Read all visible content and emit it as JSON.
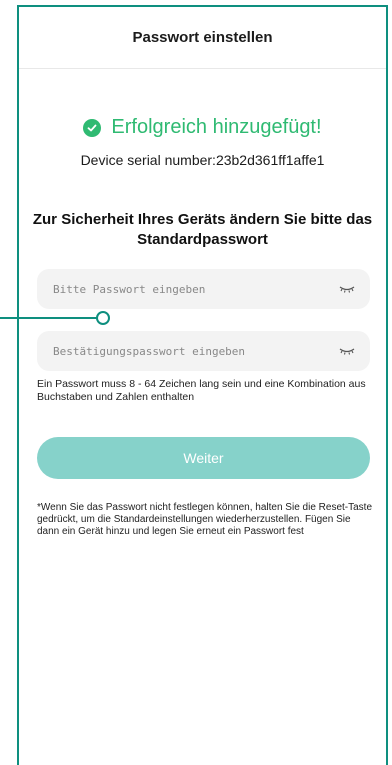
{
  "header": {
    "title": "Passwort einstellen"
  },
  "success": {
    "text": "Erfolgreich hinzugefügt!",
    "icon": "check-circle-icon",
    "color": "#2fba72"
  },
  "device": {
    "serial_line": "Device serial number:23b2d361ff1affe1"
  },
  "heading": "Zur Sicherheit Ihres Geräts ändern Sie bitte das Standardpasswort",
  "fields": {
    "password_placeholder": "Bitte Passwort eingeben",
    "confirm_placeholder": "Bestätigungspasswort eingeben"
  },
  "hint": "Ein Passwort muss 8 - 64 Zeichen lang sein und eine Kombination aus Buchstaben und Zahlen enthalten",
  "button": {
    "label": "Weiter",
    "color": "#86d2ca"
  },
  "note": "*Wenn Sie das Passwort nicht festlegen können, halten Sie die Reset-Taste gedrückt, um die Standardeinstellungen wiederherzustellen. Fügen Sie dann ein Gerät hinzu und legen Sie erneut ein Passwort fest"
}
